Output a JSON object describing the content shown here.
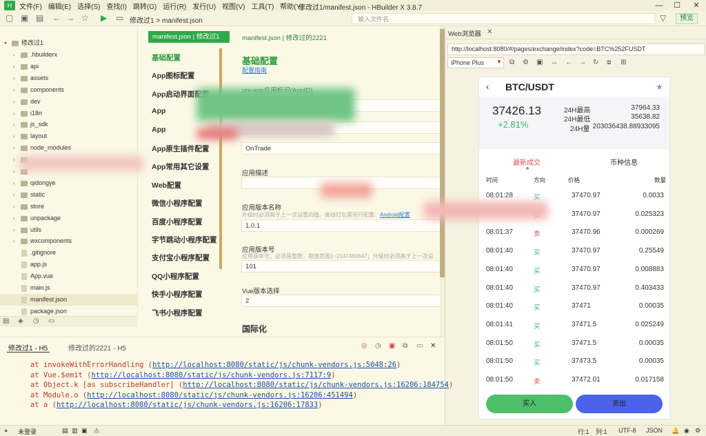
{
  "app": {
    "window_title": "修改过1/manifest.json - HBuilder X 3.8.7",
    "menu": [
      "文件(F)",
      "编辑(E)",
      "选择(S)",
      "查找(I)",
      "跳转(G)",
      "运行(R)",
      "发行(U)",
      "视图(V)",
      "工具(T)",
      "帮助(Y)"
    ]
  },
  "toolbar": {
    "breadcrumb": "修改过1 > manifest.json",
    "file_search_placeholder": "输入文件名",
    "preview_label": "预览"
  },
  "file_tree": {
    "root": "修改过1",
    "items": [
      {
        "label": ".hbuilderx",
        "type": "folder"
      },
      {
        "label": "api",
        "type": "folder"
      },
      {
        "label": "assets",
        "type": "folder"
      },
      {
        "label": "components",
        "type": "folder"
      },
      {
        "label": "dev",
        "type": "folder"
      },
      {
        "label": "i18n",
        "type": "folder"
      },
      {
        "label": "js_sdk",
        "type": "folder"
      },
      {
        "label": "layout",
        "type": "folder"
      },
      {
        "label": "node_modules",
        "type": "folder"
      },
      {
        "label": "",
        "type": "folder"
      },
      {
        "label": "",
        "type": "folder"
      },
      {
        "label": "qidongye",
        "type": "folder"
      },
      {
        "label": "static",
        "type": "folder"
      },
      {
        "label": "store",
        "type": "folder"
      },
      {
        "label": "unpackage",
        "type": "folder"
      },
      {
        "label": "utils",
        "type": "folder"
      },
      {
        "label": "wxcomponents",
        "type": "folder"
      },
      {
        "label": ".gitignore",
        "type": "file"
      },
      {
        "label": "app.js",
        "type": "file"
      },
      {
        "label": "App.vue",
        "type": "file"
      },
      {
        "label": "main.js",
        "type": "file"
      },
      {
        "label": "manifest.json",
        "type": "file",
        "active": true
      },
      {
        "label": "package.json",
        "type": "file"
      }
    ]
  },
  "editor": {
    "tab_active": "manifest.json | 修改过1",
    "tab_inactive": "manifest.json | 修改过的2221",
    "nav": [
      "基础配置",
      "App图标配置",
      "App启动界面配置",
      "App",
      "App",
      "App原生插件配置",
      "App常用其它设置",
      "Web配置",
      "微信小程序配置",
      "百度小程序配置",
      "字节跳动小程序配置",
      "支付宝小程序配置",
      "QQ小程序配置",
      "快手小程序配置",
      "飞书小程序配置"
    ],
    "section_title": "基础配置",
    "section_link": "配置指南",
    "fields": [
      {
        "label": "uni-app应用标识(AppID)",
        "hint": "",
        "value": ""
      },
      {
        "label": "",
        "hint": "",
        "value": ""
      },
      {
        "label": "",
        "hint": "",
        "value": "OnTrade"
      },
      {
        "label": "应用描述",
        "hint": "",
        "value": ""
      },
      {
        "label": "应用版本名称",
        "hint": "升级时必须高于上一次设置的值。离线打包需另行配置：",
        "hint_link": "Android配置",
        "value": "1.0.1"
      },
      {
        "label": "应用版本号",
        "hint": "应用版本号，必须是整数，取值范围1~2147483647；升级时必须高于上一次设",
        "value": "101"
      },
      {
        "label": "Vue版本选择",
        "hint": "",
        "value": "2"
      }
    ],
    "next_section": "国际化"
  },
  "browser": {
    "tab_label": "Web浏览器",
    "url": "http://localhost:8080/#/pages/exchange/index?code=BTC%252FUSDT",
    "device": "iPhone Plus"
  },
  "phone": {
    "pair": "BTC/USDT",
    "last_price": "37426.13",
    "change": "+2.81%",
    "stats": [
      {
        "label": "24H最高",
        "value": "37964.33"
      },
      {
        "label": "24H最低",
        "value": "35638.82"
      },
      {
        "label": "24H量",
        "value": "203036438.88933095"
      }
    ],
    "tabs": [
      "最新成交",
      "币种信息"
    ],
    "columns": [
      "时间",
      "方向",
      "价格",
      "数量"
    ],
    "trades": [
      {
        "time": "08:01:28",
        "dir": "买",
        "price": "37470.97",
        "qty": "0.0033"
      },
      {
        "time": "",
        "dir": "买",
        "price": "37470.97",
        "qty": "0.025323"
      },
      {
        "time": "08:01:37",
        "dir": "卖",
        "price": "37470.96",
        "qty": "0.000269"
      },
      {
        "time": "08:01:40",
        "dir": "买",
        "price": "37470.97",
        "qty": "0.25549"
      },
      {
        "time": "08:01:40",
        "dir": "买",
        "price": "37470.97",
        "qty": "0.008883"
      },
      {
        "time": "08:01:40",
        "dir": "买",
        "price": "37470.97",
        "qty": "0.403433"
      },
      {
        "time": "08:01:40",
        "dir": "买",
        "price": "37471",
        "qty": "0.00035"
      },
      {
        "time": "08:01:41",
        "dir": "买",
        "price": "37471.5",
        "qty": "0.025249"
      },
      {
        "time": "08:01:50",
        "dir": "买",
        "price": "37471.5",
        "qty": "0.00035"
      },
      {
        "time": "08:01:50",
        "dir": "买",
        "price": "37473.5",
        "qty": "0.00035"
      },
      {
        "time": "08:01:50",
        "dir": "卖",
        "price": "37472.01",
        "qty": "0.017158"
      }
    ],
    "buy_label": "买入",
    "sell_label": "卖出",
    "colors": {
      "buy": "#3cb371",
      "sell": "#e0515a"
    }
  },
  "console": {
    "tabs": [
      "修改过1 - H5",
      "修改过的2221 - H5"
    ],
    "lines": [
      {
        "prefix": "at invokeWithErrorHandling (",
        "link": "http://localhost:8080/static/js/chunk-vendors.js:5048:26",
        "suffix": ")"
      },
      {
        "prefix": "at Vue.$emit (",
        "link": "http://localhost:8080/static/js/chunk-vendors.js:7117:9",
        "suffix": ")"
      },
      {
        "prefix": "at Object.k [as subscribeHandler] (",
        "link": "http://localhost:8080/static/js/chunk-vendors.js:16206:184754",
        "suffix": ")"
      },
      {
        "prefix": "at Module.o (",
        "link": "http://localhost:8080/static/js/chunk-vendors.js:16206:451494",
        "suffix": ")"
      },
      {
        "prefix": "at a (",
        "link": "http://localhost:8080/static/js/chunk-vendors.js:16206:17833",
        "suffix": ")"
      }
    ]
  },
  "statusbar": {
    "login": "未登录",
    "position": "行:1",
    "column": "列:1",
    "encoding": "UTF-8",
    "language": "JSON"
  }
}
